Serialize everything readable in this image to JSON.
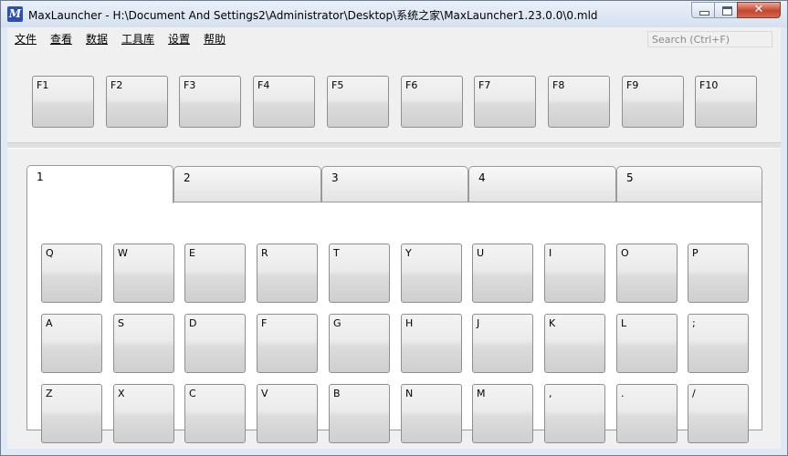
{
  "window": {
    "app_icon_letter": "M",
    "title": "MaxLauncher - H:\\Document And Settings2\\Administrator\\Desktop\\系统之家\\MaxLauncher1.23.0.0\\0.mld",
    "close_glyph": "✕"
  },
  "menu": [
    "文件",
    "查看",
    "数据",
    "工具库",
    "设置",
    "帮助"
  ],
  "search": {
    "placeholder": "Search (Ctrl+F)",
    "value": ""
  },
  "function_keys": [
    "F1",
    "F2",
    "F3",
    "F4",
    "F5",
    "F6",
    "F7",
    "F8",
    "F9",
    "F10"
  ],
  "tabs": [
    "1",
    "2",
    "3",
    "4",
    "5"
  ],
  "active_tab": "1",
  "key_rows": [
    [
      "Q",
      "W",
      "E",
      "R",
      "T",
      "Y",
      "U",
      "I",
      "O",
      "P"
    ],
    [
      "A",
      "S",
      "D",
      "F",
      "G",
      "H",
      "J",
      "K",
      "L",
      ";"
    ],
    [
      "Z",
      "X",
      "C",
      "V",
      "B",
      "N",
      "M",
      ",",
      ".",
      "/"
    ]
  ],
  "colors": {
    "title_bar": "#dce6f2",
    "close_button": "#c6442d",
    "app_icon": "#2d4fb3"
  }
}
